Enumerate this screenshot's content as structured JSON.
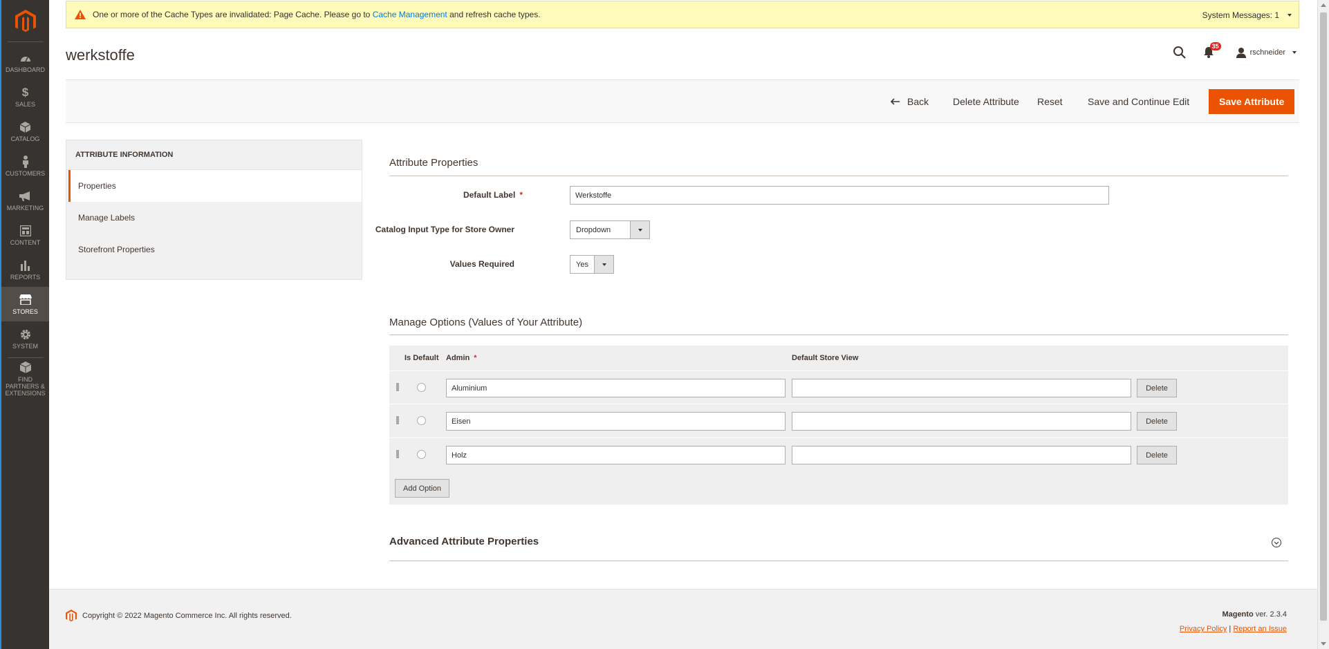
{
  "sidebar": {
    "items": [
      {
        "label": "DASHBOARD",
        "icon": "dashboard-icon"
      },
      {
        "label": "SALES",
        "icon": "dollar-icon"
      },
      {
        "label": "CATALOG",
        "icon": "box-icon"
      },
      {
        "label": "CUSTOMERS",
        "icon": "person-icon"
      },
      {
        "label": "MARKETING",
        "icon": "megaphone-icon"
      },
      {
        "label": "CONTENT",
        "icon": "layout-icon"
      },
      {
        "label": "REPORTS",
        "icon": "bar-chart-icon"
      },
      {
        "label": "STORES",
        "icon": "store-icon"
      },
      {
        "label": "SYSTEM",
        "icon": "gear-icon"
      },
      {
        "label": "FIND PARTNERS & EXTENSIONS",
        "icon": "partners-icon"
      }
    ],
    "active": "STORES"
  },
  "system_message": {
    "text_before": "One or more of the Cache Types are invalidated: Page Cache. Please go to",
    "link": "Cache Management",
    "text_after": "and refresh cache types.",
    "counter": "System Messages: 1"
  },
  "header": {
    "title": "werkstoffe",
    "notifications": "35",
    "user": "rschneider"
  },
  "page_actions": {
    "back": "Back",
    "delete": "Delete Attribute",
    "reset": "Reset",
    "save_continue": "Save and Continue Edit",
    "save": "Save Attribute"
  },
  "tabs": {
    "heading": "ATTRIBUTE INFORMATION",
    "items": [
      "Properties",
      "Manage Labels",
      "Storefront Properties"
    ]
  },
  "attribute_properties": {
    "title": "Attribute Properties",
    "default_label": {
      "label": "Default Label",
      "value": "Werkstoffe"
    },
    "input_type": {
      "label": "Catalog Input Type for Store Owner",
      "value": "Dropdown"
    },
    "values_required": {
      "label": "Values Required",
      "value": "Yes"
    }
  },
  "manage_options": {
    "title": "Manage Options (Values of Your Attribute)",
    "headers": {
      "is_default": "Is Default",
      "admin": "Admin",
      "store_view": "Default Store View"
    },
    "rows": [
      {
        "admin": "Aluminium",
        "store_view": "",
        "delete": "Delete"
      },
      {
        "admin": "Eisen",
        "store_view": "",
        "delete": "Delete"
      },
      {
        "admin": "Holz",
        "store_view": "",
        "delete": "Delete"
      }
    ],
    "add_option": "Add Option"
  },
  "advanced": {
    "title": "Advanced Attribute Properties"
  },
  "footer": {
    "copyright": "Copyright © 2022 Magento Commerce Inc. All rights reserved.",
    "brand": "Magento",
    "version": "ver. 2.3.4",
    "privacy": "Privacy Policy",
    "separator": "|",
    "report": "Report an Issue"
  },
  "colors": {
    "accent": "#eb5202",
    "sidebar": "#373330",
    "link": "#007bdb"
  }
}
